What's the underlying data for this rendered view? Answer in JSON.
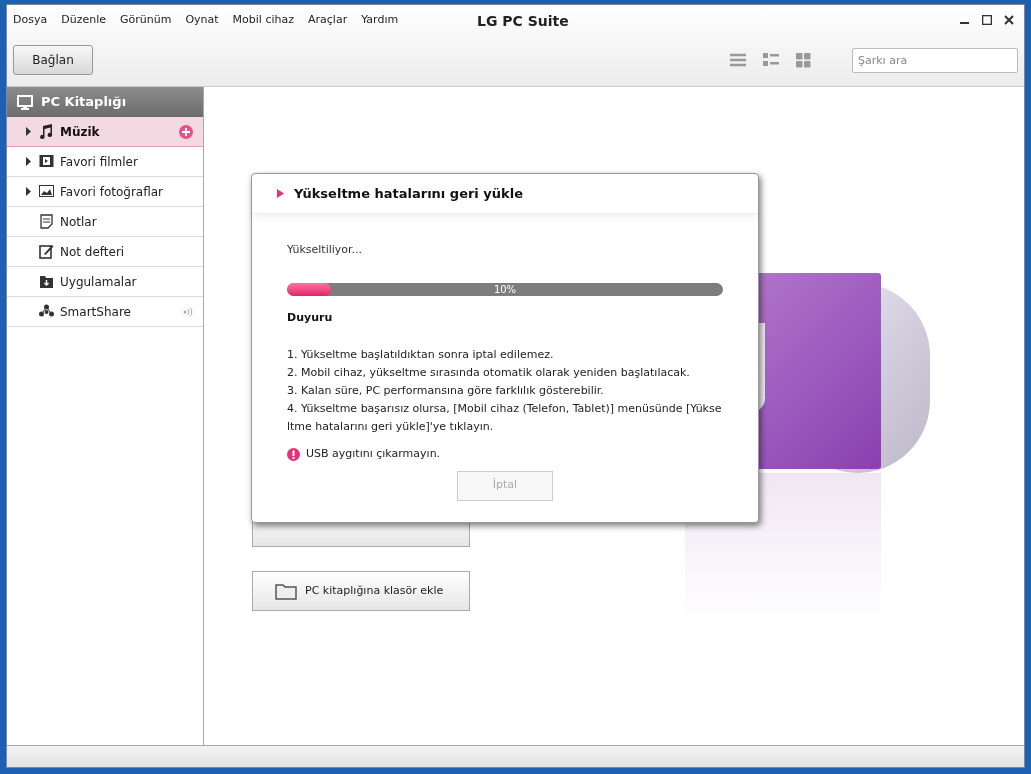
{
  "window": {
    "title": "LG PC Suite"
  },
  "menu": [
    "Dosya",
    "Düzenle",
    "Görünüm",
    "Oynat",
    "Mobil cihaz",
    "Araçlar",
    "Yardım"
  ],
  "toolbar": {
    "connect_button": "Bağlan",
    "search": {
      "placeholder": "Şarkı ara"
    }
  },
  "sidebar": {
    "header": "PC Kitaplığı",
    "items": [
      {
        "label": "Müzik",
        "kind": "music",
        "expandable": true,
        "selected": true
      },
      {
        "label": "Favori filmler",
        "kind": "film",
        "expandable": true,
        "selected": false
      },
      {
        "label": "Favori fotoğraflar",
        "kind": "photo",
        "expandable": true,
        "selected": false
      },
      {
        "label": "Notlar",
        "kind": "note",
        "expandable": false,
        "selected": false
      },
      {
        "label": "Not defteri",
        "kind": "notebook",
        "expandable": false,
        "selected": false
      },
      {
        "label": "Uygulamalar",
        "kind": "apps",
        "expandable": false,
        "selected": false
      },
      {
        "label": "SmartShare",
        "kind": "share",
        "expandable": false,
        "selected": false
      }
    ]
  },
  "main": {
    "add_folder_button": "PC kitaplığına klasör ekle"
  },
  "dialog": {
    "title": "Yükseltme hatalarını geri yükle",
    "status": "Yükseltiliyor...",
    "progress": {
      "level": 0.1,
      "reading": "10%"
    },
    "notice_heading": "Duyuru",
    "notices": [
      "1. Yükseltme başlatıldıktan sonra iptal edilemez.",
      "2. Mobil cihaz, yükseltme sırasında otomatik olarak yeniden başlatılacak.",
      "3. Kalan süre, PC performansına göre farklılık gösterebilir.",
      "4. Yükseltme başarısız olursa, [Mobil cihaz (Telefon, Tablet)] menüsünde [Yükse ltme hatalarını geri yükle]'ye tıklayın."
    ],
    "warning": "USB aygıtını çıkarmayın.",
    "cancel_button": {
      "label": "İptal",
      "disabled": true
    }
  }
}
